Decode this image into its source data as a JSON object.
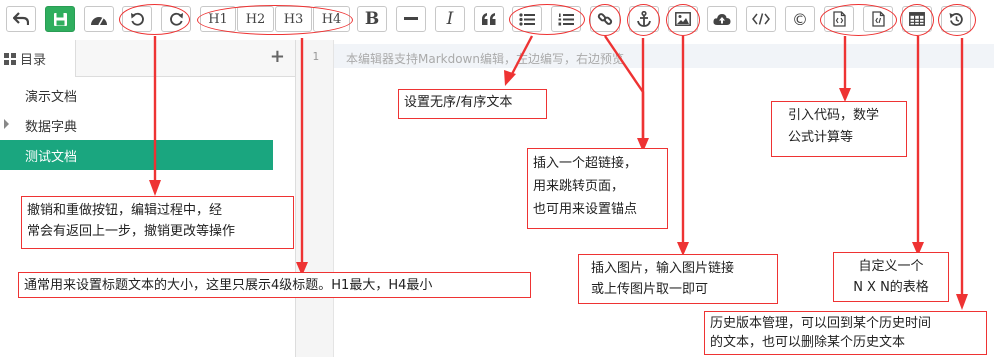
{
  "toolbar": {
    "headings": [
      "H1",
      "H2",
      "H3",
      "H4"
    ],
    "bold": "B",
    "italic": "I",
    "copyright": "©"
  },
  "sidebar": {
    "tab_label": "目录",
    "add_icon": "+",
    "items": [
      {
        "label": "演示文档"
      },
      {
        "label": "数据字典"
      },
      {
        "label": "测试文档"
      }
    ]
  },
  "editor": {
    "line_number": "1",
    "placeholder": "本编辑器支持Markdown编辑，左边编写，右边预览"
  },
  "annotations": {
    "lists": "设置无序/有序文本",
    "link_line1": "插入一个超链接，",
    "link_line2": "用来跳转页面，",
    "link_line3": "也可用来设置锚点",
    "code_line1": "引入代码，数学",
    "code_line2": "公式计算等",
    "undo_line1": "撤销和重做按钮，编辑过程中，经",
    "undo_line2": "常会有返回上一步，撤销更改等操作",
    "headings": "通常用来设置标题文本的大小，这里只展示4级标题。H1最大，H4最小",
    "image_line1": "插入图片，输入图片链接",
    "image_line2": "或上传图片取一即可",
    "table_line1": "自定义一个",
    "table_line2": "N X N的表格",
    "history_line1": "历史版本管理，可以回到某个历史时间",
    "history_line2": "的文本，也可以删除某个历史文本"
  },
  "colors": {
    "accent_red": "#e33333",
    "active_green": "#1aa67f",
    "save_green": "#2fae5e"
  }
}
